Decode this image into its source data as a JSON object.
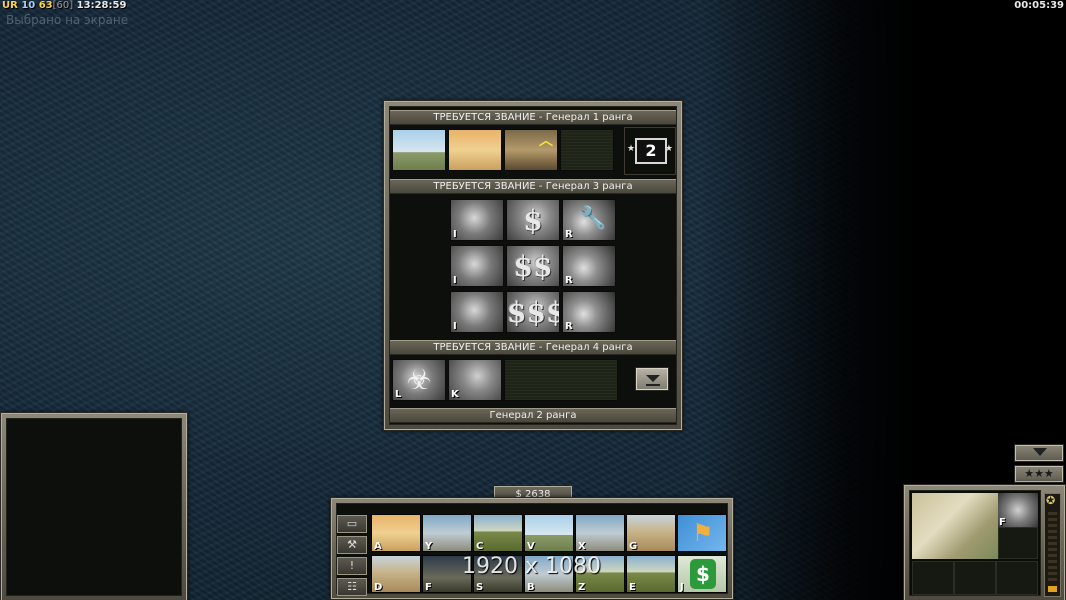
{
  "hud": {
    "ur_label": "UR",
    "level": "10",
    "fps": "63",
    "fps_cap": "[60]",
    "clock": "13:28:59",
    "selection_text": "Выбрано на экране",
    "game_timer": "00:05:39"
  },
  "promotion": {
    "rank1_header": "ТРЕБУЕТСЯ ЗВАНИЕ - Генерал 1 ранга",
    "rank3_header": "ТРЕБУЕТСЯ ЗВАНИЕ - Генерал 3 ранга",
    "rank4_header": "ТРЕБУЕТСЯ ЗВАНИЕ - Генерал 4 ранга",
    "points_available": "2",
    "current_rank": "Генерал 2 ранга",
    "rank3_row1_keys": [
      "I",
      "",
      "R"
    ],
    "rank3_row2_keys": [
      "I",
      "",
      "R"
    ],
    "rank3_row3_keys": [
      "I",
      "",
      "R"
    ],
    "rank4_keys": [
      "L",
      "K"
    ]
  },
  "economy": {
    "money": "$ 2638"
  },
  "command_bar": {
    "row1_keys": [
      "A",
      "Y",
      "C",
      "V",
      "X",
      "G",
      ""
    ],
    "row2_keys": [
      "D",
      "F",
      "S",
      "B",
      "Z",
      "E",
      "J"
    ],
    "side_buttons": [
      "▭",
      "⚒",
      "!",
      "☷"
    ]
  },
  "overlay": {
    "resolution": "1920 x 1080"
  },
  "minimap": {
    "structure_key": "F"
  }
}
